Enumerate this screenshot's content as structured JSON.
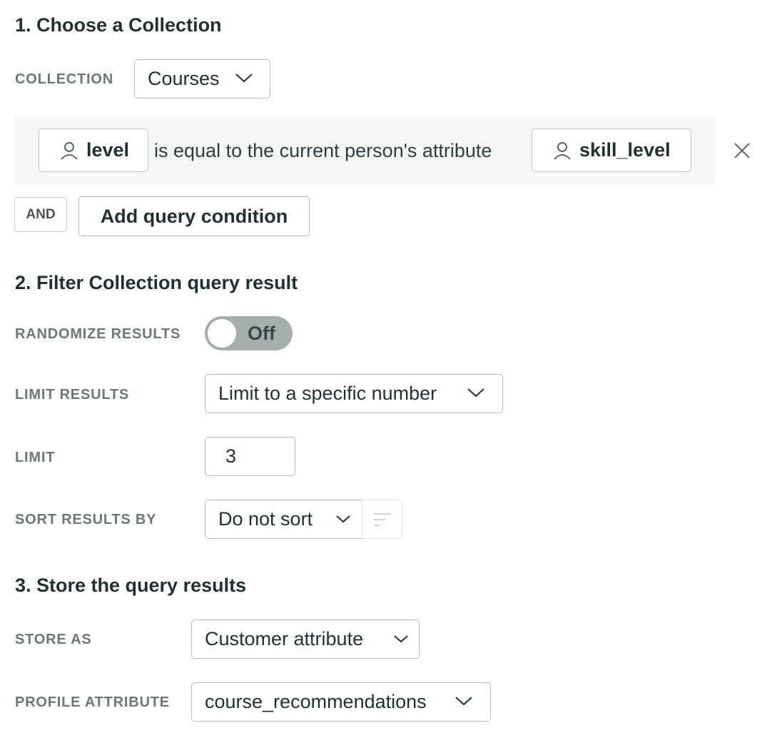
{
  "section1": {
    "title": "1. Choose a Collection",
    "collection_label": "COLLECTION",
    "collection_value": "Courses",
    "condition": {
      "field": "level",
      "operator_text": "is equal to the current person's attribute",
      "attribute": "skill_level"
    },
    "and_label": "AND",
    "add_condition_label": "Add query condition"
  },
  "section2": {
    "title": "2. Filter Collection query result",
    "randomize_label": "RANDOMIZE RESULTS",
    "randomize_state": "Off",
    "limit_results_label": "LIMIT RESULTS",
    "limit_results_value": "Limit to a specific number",
    "limit_label": "LIMIT",
    "limit_value": "3",
    "sort_label": "SORT RESULTS BY",
    "sort_value": "Do not sort"
  },
  "section3": {
    "title": "3. Store the query results",
    "store_as_label": "STORE AS",
    "store_as_value": "Customer attribute",
    "profile_attribute_label": "PROFILE ATTRIBUTE",
    "profile_attribute_value": "course_recommendations"
  },
  "icons": {
    "chevron": "chevron-down-icon",
    "person": "person-icon",
    "close": "close-icon",
    "sort": "sort-lines-icon"
  }
}
